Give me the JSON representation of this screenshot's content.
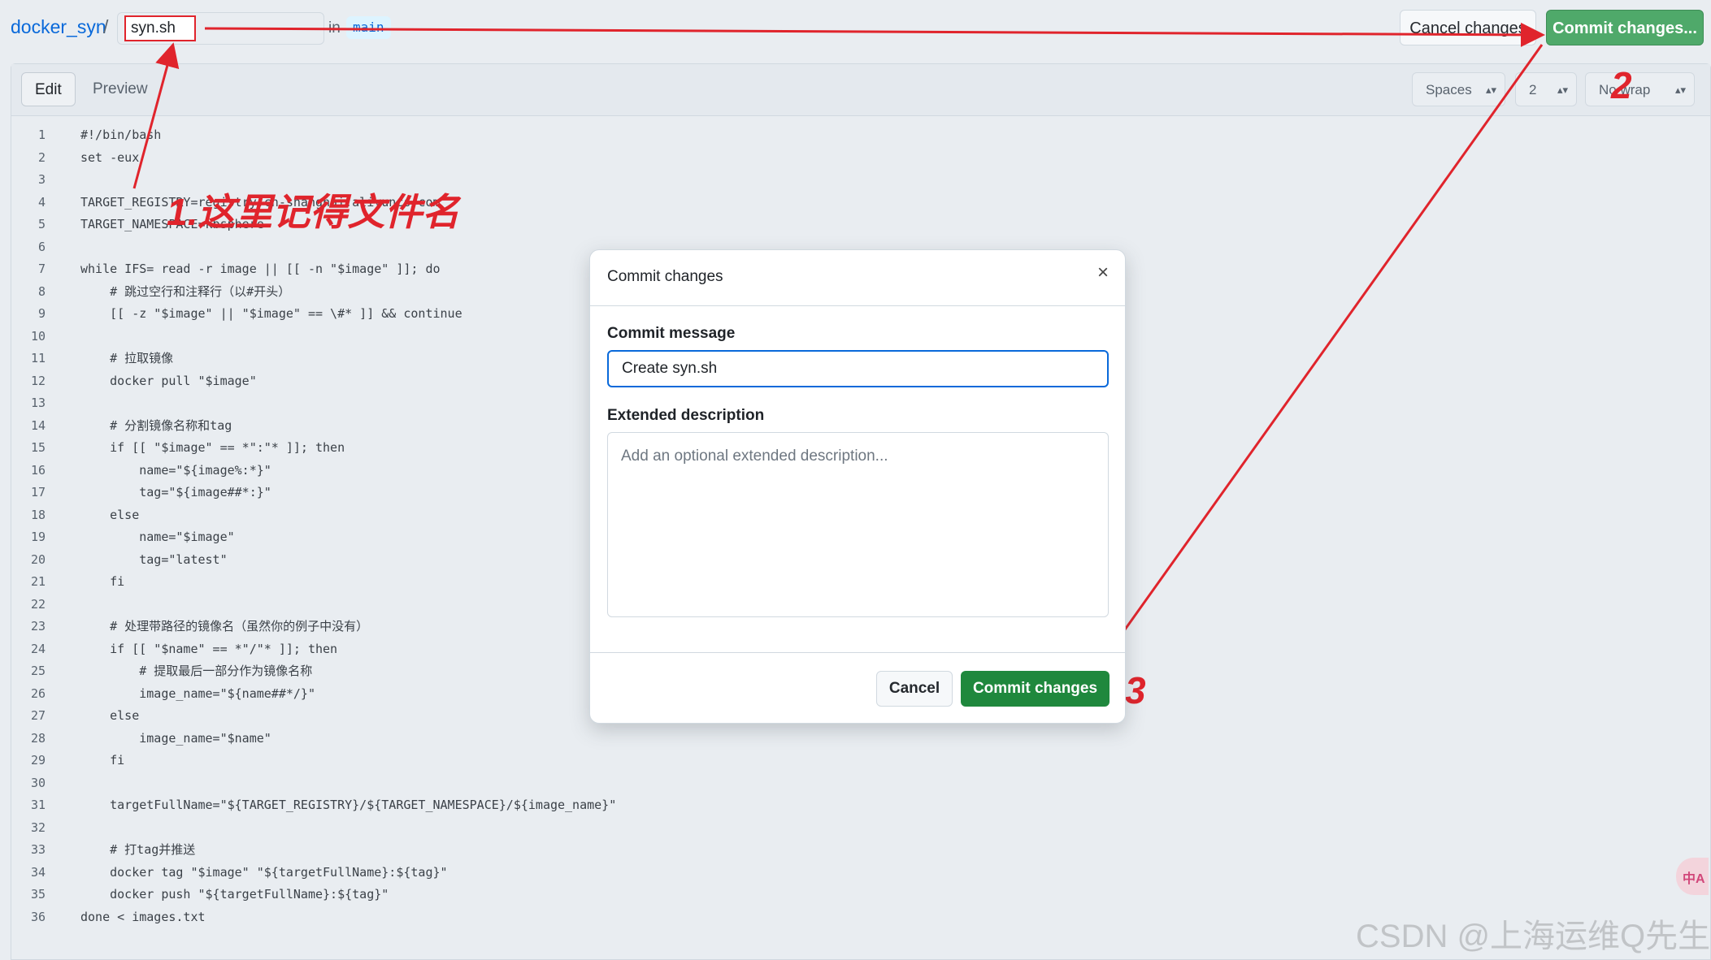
{
  "header": {
    "repo": "docker_syn",
    "slash": "/",
    "filename": "syn.sh",
    "in_label": "in",
    "branch": "main",
    "cancel_label": "Cancel changes",
    "commit_label": "Commit changes..."
  },
  "editor": {
    "tab_edit": "Edit",
    "tab_preview": "Preview",
    "indent_mode": "Spaces",
    "indent_size": "2",
    "wrap_mode": "No wrap",
    "lines": [
      "#!/bin/bash",
      "set -eux",
      "",
      "TARGET_REGISTRY=registry.cn-shanghai.aliyuncs.com",
      "TARGET_NAMESPACE=kbsphere",
      "",
      "while IFS= read -r image || [[ -n \"$image\" ]]; do",
      "    # 跳过空行和注释行（以#开头）",
      "    [[ -z \"$image\" || \"$image\" == \\#* ]] && continue",
      "",
      "    # 拉取镜像",
      "    docker pull \"$image\"",
      "",
      "    # 分割镜像名称和tag",
      "    if [[ \"$image\" == *\":\"* ]]; then",
      "        name=\"${image%:*}\"",
      "        tag=\"${image##*:}\"",
      "    else",
      "        name=\"$image\"",
      "        tag=\"latest\"",
      "    fi",
      "",
      "    # 处理带路径的镜像名（虽然你的例子中没有）",
      "    if [[ \"$name\" == *\"/\"* ]]; then",
      "        # 提取最后一部分作为镜像名称",
      "        image_name=\"${name##*/}\"",
      "    else",
      "        image_name=\"$name\"",
      "    fi",
      "",
      "    targetFullName=\"${TARGET_REGISTRY}/${TARGET_NAMESPACE}/${image_name}\"",
      "",
      "    # 打tag并推送",
      "    docker tag \"$image\" \"${targetFullName}:${tag}\"",
      "    docker push \"${targetFullName}:${tag}\"",
      "done < images.txt"
    ]
  },
  "dialog": {
    "title": "Commit changes",
    "close_glyph": "×",
    "message_label": "Commit message",
    "message_value": "Create syn.sh",
    "description_label": "Extended description",
    "description_placeholder": "Add an optional extended description...",
    "cancel_label": "Cancel",
    "commit_label": "Commit changes"
  },
  "annotations": {
    "note1": "1.这里记得文件名",
    "note2": "2",
    "note3": "3",
    "color": "#e0242c"
  },
  "watermark": "CSDN @上海运维Q先生",
  "translate_badge": "中A"
}
